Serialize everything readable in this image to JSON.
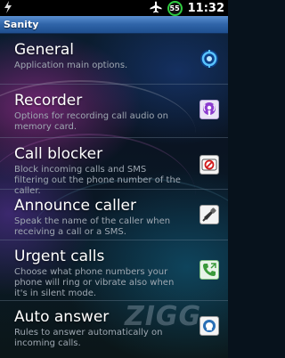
{
  "status_bar": {
    "left_icon": "usb-debug-icon",
    "airplane_icon": "airplane-icon",
    "battery_level": "55",
    "time": "11:32"
  },
  "app": {
    "title": "Sanity"
  },
  "items": [
    {
      "title": "General",
      "description": "Application main options.",
      "icon": "general-settings-icon"
    },
    {
      "title": "Recorder",
      "description": "Options for recording call audio on memory card.",
      "icon": "podcast-recorder-icon"
    },
    {
      "title": "Call blocker",
      "description": "Block incoming calls and SMS filtering out the phone number of the caller.",
      "icon": "blocked-phone-icon"
    },
    {
      "title": "Announce caller",
      "description": "Speak the name of the caller when receiving a call or a SMS.",
      "icon": "megaphone-icon"
    },
    {
      "title": "Urgent calls",
      "description": "Choose what phone numbers your phone will ring or vibrate also when it's in silent mode.",
      "icon": "phone-handset-icon"
    },
    {
      "title": "Auto answer",
      "description": "Rules to answer automatically on incoming calls.",
      "icon": "auto-answer-icon"
    }
  ],
  "watermark": "ZIGG",
  "colors": {
    "titlebar": "#2f64a8",
    "battery_ring": "#2ecc40",
    "description_text": "#9fa8b2"
  }
}
